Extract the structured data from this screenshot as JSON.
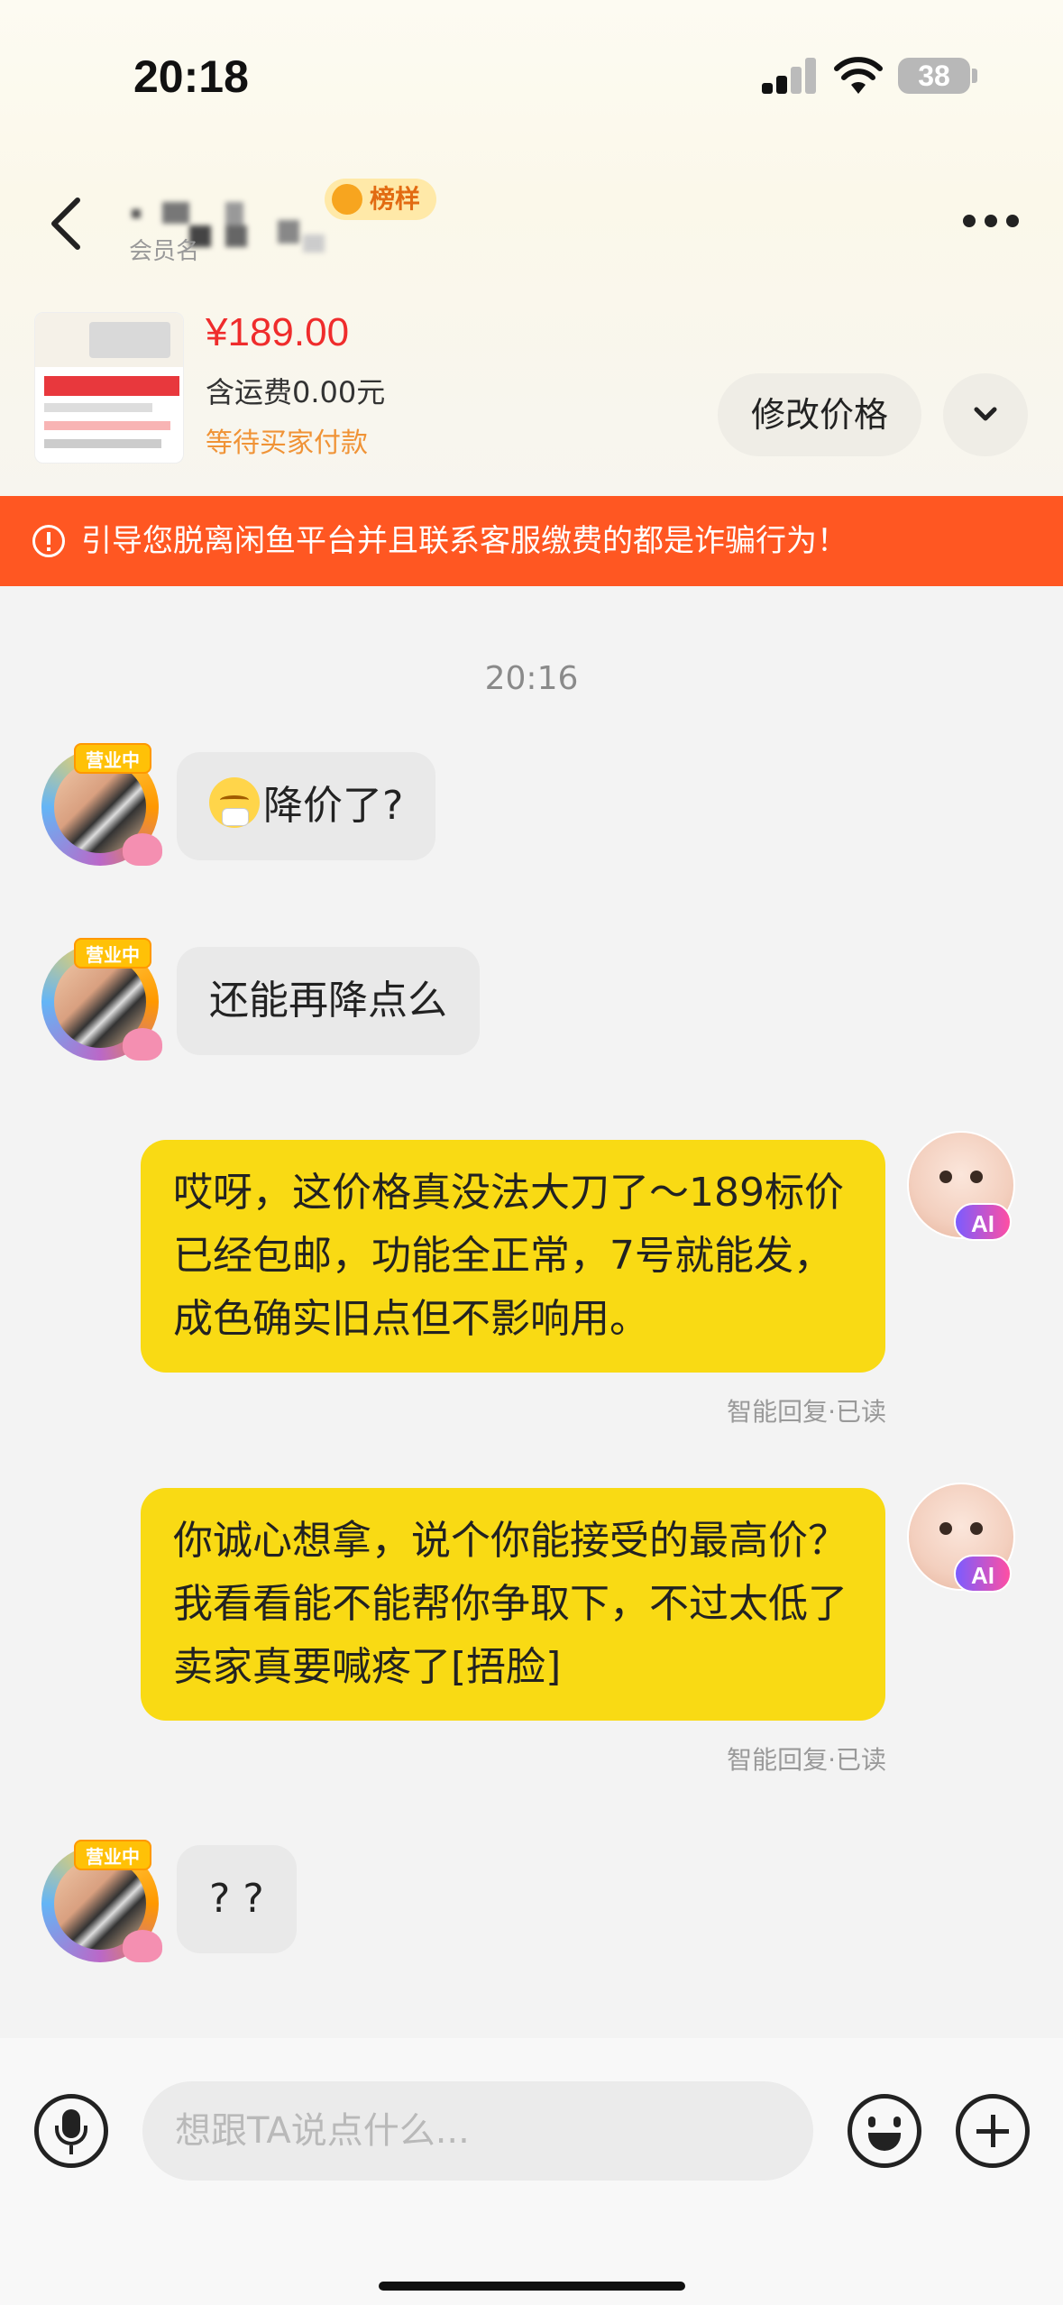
{
  "status_bar": {
    "time": "20:18",
    "battery": "38"
  },
  "header": {
    "badge_text": "榜样",
    "member_label": "会员名"
  },
  "product": {
    "price": "¥189.00",
    "shipping": "含运费0.00元",
    "status": "等待买家付款",
    "edit_price_label": "修改价格"
  },
  "warning": {
    "text": "引导您脱离闲鱼平台并且联系客服缴费的都是诈骗行为！",
    "color": "#ff5722"
  },
  "chat": {
    "timestamp": "20:16",
    "avatar_tag": "营业中",
    "messages": [
      {
        "side": "left",
        "text": "降价了?",
        "has_emoji": true
      },
      {
        "side": "left",
        "text": "还能再降点么"
      },
      {
        "side": "right",
        "text": "哎呀，这价格真没法大刀了～189标价已经包邮，功能全正常，7号就能发，成色确实旧点但不影响用。",
        "meta": "智能回复·已读"
      },
      {
        "side": "right",
        "text": "你诚心想拿，说个你能接受的最高价？我看看能不能帮你争取下，不过太低了卖家真要喊疼了[捂脸]",
        "meta": "智能回复·已读"
      },
      {
        "side": "left",
        "text": "? ?"
      }
    ],
    "ai_badge": "AI",
    "bubble_color_right": "#f9da14",
    "bubble_color_left": "#e9e9e9"
  },
  "input_bar": {
    "placeholder": "想跟TA说点什么..."
  },
  "icons": [
    "back-icon",
    "more-icon",
    "chevron-down-icon",
    "warning-icon",
    "mic-icon",
    "emoji-icon",
    "plus-icon"
  ]
}
